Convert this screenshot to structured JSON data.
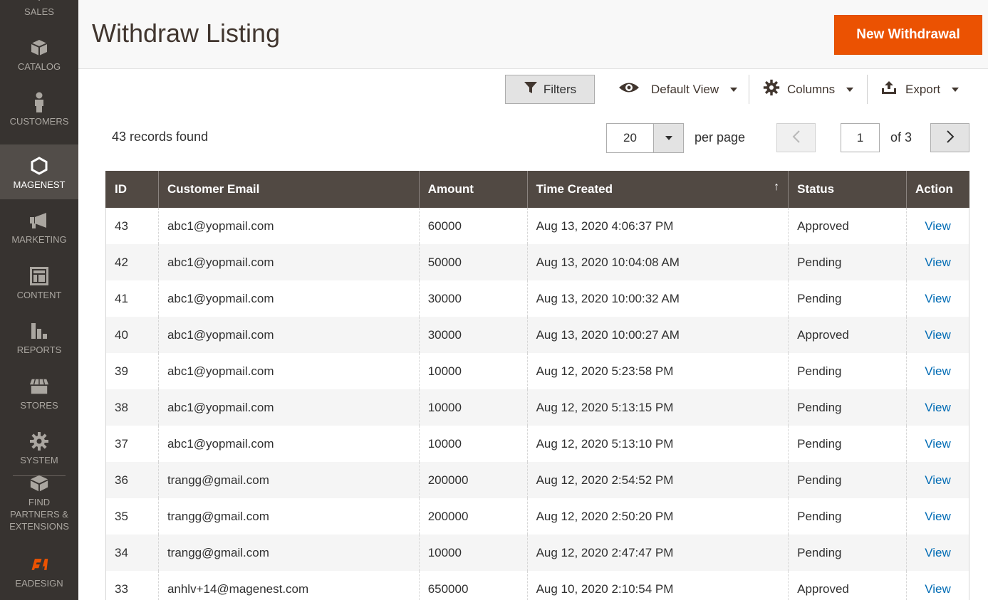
{
  "sidebar": {
    "items": [
      {
        "label": "SALES",
        "icon": "dollar-icon"
      },
      {
        "label": "CATALOG",
        "icon": "box-icon"
      },
      {
        "label": "CUSTOMERS",
        "icon": "person-icon"
      },
      {
        "label": "MAGENEST",
        "icon": "hexagon-icon"
      },
      {
        "label": "MARKETING",
        "icon": "megaphone-icon"
      },
      {
        "label": "CONTENT",
        "icon": "layout-icon"
      },
      {
        "label": "REPORTS",
        "icon": "bar-chart-icon"
      },
      {
        "label": "STORES",
        "icon": "store-icon"
      },
      {
        "label": "SYSTEM",
        "icon": "gear-icon"
      },
      {
        "label": "FIND PARTNERS & EXTENSIONS",
        "icon": "blocks-icon"
      },
      {
        "label": "EADESIGN",
        "icon": "ea-logo-icon"
      }
    ],
    "active": "MAGENEST"
  },
  "header": {
    "title": "Withdraw Listing",
    "new_button": "New Withdrawal"
  },
  "toolbar": {
    "filters": "Filters",
    "view": "Default View",
    "columns": "Columns",
    "export": "Export"
  },
  "pagination": {
    "records_found": "43 records found",
    "per_page_value": "20",
    "per_page_label": "per page",
    "current_page": "1",
    "of_pages": "of 3"
  },
  "grid": {
    "columns": [
      "ID",
      "Customer Email",
      "Amount",
      "Time Created",
      "Status",
      "Action"
    ],
    "sorted_column": "Time Created",
    "rows": [
      {
        "id": "43",
        "email": "abc1@yopmail.com",
        "amount": "60000",
        "time": "Aug 13, 2020 4:06:37 PM",
        "status": "Approved",
        "action": "View"
      },
      {
        "id": "42",
        "email": "abc1@yopmail.com",
        "amount": "50000",
        "time": "Aug 13, 2020 10:04:08 AM",
        "status": "Pending",
        "action": "View"
      },
      {
        "id": "41",
        "email": "abc1@yopmail.com",
        "amount": "30000",
        "time": "Aug 13, 2020 10:00:32 AM",
        "status": "Pending",
        "action": "View"
      },
      {
        "id": "40",
        "email": "abc1@yopmail.com",
        "amount": "30000",
        "time": "Aug 13, 2020 10:00:27 AM",
        "status": "Approved",
        "action": "View"
      },
      {
        "id": "39",
        "email": "abc1@yopmail.com",
        "amount": "10000",
        "time": "Aug 12, 2020 5:23:58 PM",
        "status": "Pending",
        "action": "View"
      },
      {
        "id": "38",
        "email": "abc1@yopmail.com",
        "amount": "10000",
        "time": "Aug 12, 2020 5:13:15 PM",
        "status": "Pending",
        "action": "View"
      },
      {
        "id": "37",
        "email": "abc1@yopmail.com",
        "amount": "10000",
        "time": "Aug 12, 2020 5:13:10 PM",
        "status": "Pending",
        "action": "View"
      },
      {
        "id": "36",
        "email": "trangg@gmail.com",
        "amount": "200000",
        "time": "Aug 12, 2020 2:54:52 PM",
        "status": "Pending",
        "action": "View"
      },
      {
        "id": "35",
        "email": "trangg@gmail.com",
        "amount": "200000",
        "time": "Aug 12, 2020 2:50:20 PM",
        "status": "Pending",
        "action": "View"
      },
      {
        "id": "34",
        "email": "trangg@gmail.com",
        "amount": "10000",
        "time": "Aug 12, 2020 2:47:47 PM",
        "status": "Pending",
        "action": "View"
      },
      {
        "id": "33",
        "email": "anhlv+14@magenest.com",
        "amount": "650000",
        "time": "Aug 10, 2020 2:10:54 PM",
        "status": "Approved",
        "action": "View"
      }
    ]
  },
  "colors": {
    "sidebar_bg": "#373330",
    "sidebar_active": "#524d49",
    "primary_button": "#eb5202",
    "grid_header": "#514943",
    "link": "#006bb4"
  }
}
